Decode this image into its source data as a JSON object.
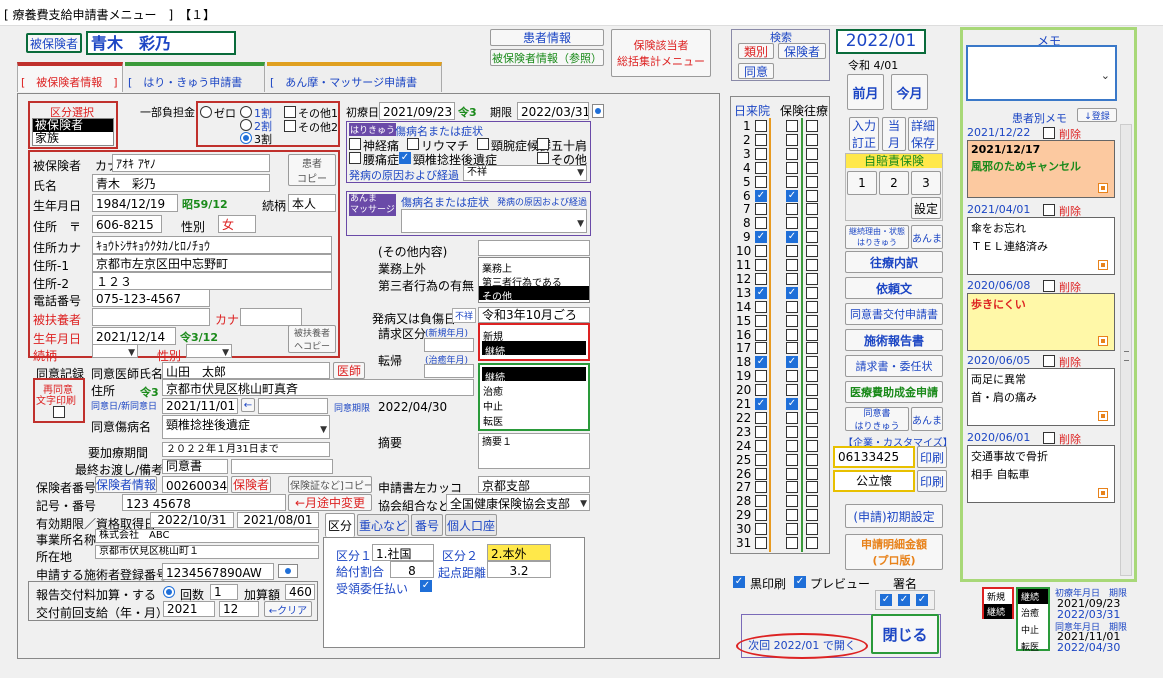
{
  "title": "[ 療養費支給申請書メニュー　]　【１】",
  "patient": {
    "insured_btn": "被保険者",
    "name": "青木　彩乃"
  },
  "top_links": {
    "patient_info": "患者情報",
    "insured_ref": "被保険者情報（参照）",
    "insurer_summary_1": "保険該当者",
    "insurer_summary_2": "総括集計メニュー"
  },
  "search": {
    "title": "検索",
    "btn1": "類別",
    "btn2": "保険者",
    "btn3": "同意"
  },
  "period": {
    "ym": "2022/01",
    "wareki": "令和 4/01",
    "prev": "前月",
    "this": "今月"
  },
  "tabs": {
    "t1": "[　被保険者情報　]",
    "t2": "[　はり・きゅう申請書",
    "t3": "[　あん摩・マッサージ申請書"
  },
  "kubun": {
    "title": "区分選択",
    "opt1": "被保険者",
    "opt2": "家族"
  },
  "futan": {
    "label": "一部負担金",
    "zero": "ゼロ",
    "w1": "1割",
    "w2": "2割",
    "w3": "3割",
    "other1": "その他1",
    "other2": "その他2"
  },
  "first_day": {
    "label": "初療日",
    "date": "2021/09/23",
    "rei": "令3",
    "kigen_label": "期限",
    "kigen": "2022/03/31"
  },
  "hari": {
    "title": "はりきゅう",
    "sub": "傷病名または症状",
    "s1": "神経痛",
    "s2": "リウマチ",
    "s3": "頸腕症候群",
    "s4": "五十肩",
    "s5": "腰痛症",
    "s6": "頸椎捻挫後遺症",
    "s7": "その他",
    "cause_label": "発病の原因および経過",
    "cause_val": "不祥"
  },
  "anma": {
    "title1": "あんま",
    "title2": "マッサージ",
    "sub": "傷病名または症状",
    "sub2": "発病の原因および経過"
  },
  "insured": {
    "l_kana": "被保険者",
    "l_kana2": "カナ",
    "kana": "ｱｵｷ ｱﾔﾉ",
    "copy1": "患者",
    "copy2": "コピー",
    "l_name": "氏名",
    "name": "青木　彩乃",
    "l_birth": "生年月日",
    "birth": "1984/12/19",
    "birth_w": "昭59/12",
    "l_rel": "続柄",
    "rel": "本人",
    "l_addr": "住所　〒",
    "zip": "606-8215",
    "l_sex": "性別",
    "sex": "女",
    "l_addr_kana": "住所カナ",
    "addr_kana": "ｷｮｳﾄｼｻｷｮｳｸﾀｶﾉﾋﾛﾉﾁｮｳ",
    "l_addr1": "住所-1",
    "addr1": "京都市左京区田中忘野町",
    "l_addr2": "住所-2",
    "addr2": "１２３",
    "l_tel": "電話番号",
    "tel": "075-123-4567"
  },
  "dependent": {
    "l_name": "被扶養者",
    "l_kana": "カナ",
    "l_birth": "生年月日",
    "birth": "2021/12/14",
    "birth_w": "令3/12",
    "copy1": "被扶養者",
    "copy2": "ヘコピー",
    "l_rel": "続柄",
    "l_sex": "性別"
  },
  "other": {
    "content": "(その他内容)",
    "l_work": "業務上外",
    "l_third": "第三者行為の有無",
    "w1": "業務上",
    "w2": "第三者行為である",
    "w3": "その他"
  },
  "onset": {
    "label": "発病又は負傷日",
    "unk": "不祥",
    "val": "令和3年10月ごろ",
    "l_seikyu": "請求区分",
    "l_seikyu2": "(新規年月)",
    "new": "新規",
    "cont": "継続",
    "l_tenki": "転帰",
    "l_tenki2": "(治癒年月)",
    "k1": "継続",
    "k2": "治癒",
    "k3": "中止",
    "k4": "転医"
  },
  "consent": {
    "l_rec": "同意記録",
    "l_doc": "同意医師氏名",
    "doc": "山田　太郎",
    "doc_btn": "医師",
    "reprint1": "再同意",
    "reprint2": "文字印刷",
    "l_addr": "住所",
    "rei": "令3",
    "addr": "京都市伏見区桃山町真斉",
    "l_date": "同意日/新同意日",
    "date": "2021/11/01",
    "l_kigen": "同意期限",
    "kigen": "2022/04/30",
    "l_dis": "同意傷病名",
    "dis": "頸椎捻挫後遺症",
    "l_summary": "摘要",
    "summary": "摘要１",
    "l_period": "要加療期間",
    "period": "２０２２年１月31日まで",
    "l_last": "最終お渡し/備考",
    "last": "同意書"
  },
  "insurer": {
    "l_no": "保険者番号",
    "info_btn": "保険者情報",
    "no": "00260034",
    "btn": "保険者",
    "copy_btn": "[保険証など]コピー",
    "l_left": "申請書左カッコ",
    "left": "京都支部",
    "l_code": "記号・番号",
    "code": "123 45678",
    "change_btn": "←月途中変更",
    "l_kyokai": "協会組合など",
    "kyokai": "全国健康保険協会支部"
  },
  "validity": {
    "l": "有効期限／資格取得日",
    "d1": "2022/10/31",
    "d2": "2021/08/01",
    "l_office": "事業所名称",
    "office": "株式会社　ABC",
    "l_loc": "所在地",
    "loc": "京都市伏見区桃山町１",
    "l_reg": "申請する施術者登録番号",
    "reg": "1234567890AW"
  },
  "report": {
    "l": "報告交付料加算・する",
    "count_label": "回数",
    "count": "1",
    "add_label": "加算額",
    "add": "460",
    "l_prev": "交付前回支給（年・月）",
    "year": "2021",
    "month": "12",
    "clear": "←クリア"
  },
  "subtabs": {
    "t1": "区分",
    "t2": "重心など",
    "t3": "番号",
    "t4": "個人口座"
  },
  "kbn": {
    "l1": "区分１",
    "v1": "1.社国",
    "l2": "区分２",
    "v2": "2.本外",
    "l_rate": "給付割合",
    "rate": "8",
    "l_dist": "起点距離",
    "dist": "3.2",
    "l_juryo": "受領委任払い"
  },
  "days": {
    "h_day": "日",
    "h_visit": "来院",
    "h_hoken": "保険",
    "h_ou": "往療",
    "list": [
      "1",
      "2",
      "3",
      "4",
      "5",
      "6",
      "7",
      "8",
      "9",
      "10",
      "11",
      "12",
      "13",
      "14",
      "15",
      "16",
      "17",
      "18",
      "19",
      "20",
      "21",
      "22",
      "23",
      "24",
      "25",
      "26",
      "27",
      "28",
      "29",
      "30",
      "31"
    ]
  },
  "right": {
    "b_input1": "入力",
    "b_input2": "訂正",
    "b_this1": "当",
    "b_this2": "月",
    "b_detail1": "詳細",
    "b_detail2": "保存",
    "jibai": "自賠責保険",
    "j1": "1",
    "j2": "2",
    "j3": "3",
    "set": "設定",
    "sel1": "継続理由・状態",
    "sel2": "はりきゅう",
    "anma": "あんま",
    "ouryo": "往療内訳",
    "irai": "依頼文",
    "doisho": "同意書交付申請書",
    "sejutsu": "施術報告書",
    "seikyu": "請求書・委任状",
    "iryo": "医療費助成金申請",
    "doisho2_1": "同意書",
    "doisho2_2": "はりきゅう",
    "anma2": "あんま",
    "kigyo": "【企業・カスタマイズ】",
    "code1": "06133425",
    "print1": "印刷",
    "kohi": "公立懐",
    "print2": "印刷",
    "init": "(申請)初期設定",
    "meisai1": "申請明細金額",
    "meisai2": "(プロ版)"
  },
  "bottom": {
    "black": "黒印刷",
    "preview": "プレビュー",
    "sign": "署名",
    "next": "次回 2022/01 で開く",
    "close": "閉じる",
    "shin": "新規",
    "kei": "継続",
    "k1": "継続",
    "k2": "治癒",
    "k3": "中止",
    "k4": "転医",
    "l_first": "初療年月日　期限",
    "first": "2021/09/23",
    "limit": "2022/03/31",
    "l_agree": "同意年月日　期限",
    "agree": "2021/11/01",
    "agree_limit": "2022/04/30"
  },
  "memo": {
    "title": "メモ",
    "patient_memo": "患者別メモ",
    "register": "↓登録",
    "del": "削除",
    "entries": [
      {
        "date": "2021/12/22",
        "l1": "2021/12/17",
        "l2": "風邪のためキャンセル"
      },
      {
        "date": "2021/04/01",
        "l1": "傘をお忘れ",
        "l2": "ＴＥＬ連絡済み"
      },
      {
        "date": "2020/06/08",
        "l1": "歩きにくい",
        "l2": ""
      },
      {
        "date": "2020/06/05",
        "l1": "両足に異常",
        "l2": "首・肩の痛み"
      },
      {
        "date": "2020/06/01",
        "l1": "交通事故で骨折",
        "l2": "相手 自転車"
      }
    ]
  },
  "colors": {
    "accent": "#1f6fd8",
    "red": "#d22222",
    "green": "#1a8a1a",
    "memo_orange": "#fcc9a0",
    "memo_yellow": "#fff8a8"
  }
}
